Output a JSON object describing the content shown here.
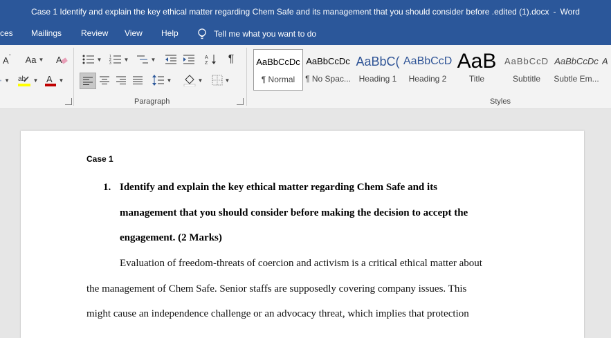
{
  "window": {
    "document_title": "Case 1 Identify and explain the key ethical matter regarding Chem Safe and its management that you should consider before .edited (1).docx",
    "separator": "-",
    "app_name": "Word"
  },
  "tabs": [
    "ces",
    "Mailings",
    "Review",
    "View",
    "Help"
  ],
  "tell_me": "Tell me what you want to do",
  "ribbon": {
    "font_case_label": "Aa",
    "paragraph_group_label": "Paragraph",
    "styles_group_label": "Styles",
    "styles": [
      {
        "sample": "AaBbCcDc",
        "name": "¶ Normal"
      },
      {
        "sample": "AaBbCcDc",
        "name": "¶ No Spac..."
      },
      {
        "sample": "AaBbC(",
        "name": "Heading 1"
      },
      {
        "sample": "AaBbCcD",
        "name": "Heading 2"
      },
      {
        "sample": "AaB",
        "name": "Title"
      },
      {
        "sample": "AaBbCcD",
        "name": "Subtitle"
      },
      {
        "sample": "AaBbCcDc",
        "name": "Subtle Em..."
      },
      {
        "sample": "A",
        "name": ""
      }
    ]
  },
  "document": {
    "heading": "Case 1",
    "question_number": "1.",
    "question_lines": [
      "Identify and explain the key ethical matter regarding Chem Safe and its",
      "management that you should consider before making the decision to accept the",
      "engagement. (2 Marks)"
    ],
    "body_lines": [
      "Evaluation of freedom-threats of coercion and activism is a critical ethical matter about",
      "the management of Chem Safe. Senior staffs are supposedly covering company issues. This",
      "might cause an independence challenge or an advocacy threat, which implies that protection"
    ]
  },
  "colors": {
    "word_blue": "#2b579a",
    "ribbon_bg": "#f3f3f3",
    "doc_bg": "#e6e6e6",
    "heading_blue": "#2f5496",
    "font_color_red": "#c00000",
    "highlight_yellow": "#ffff00"
  }
}
